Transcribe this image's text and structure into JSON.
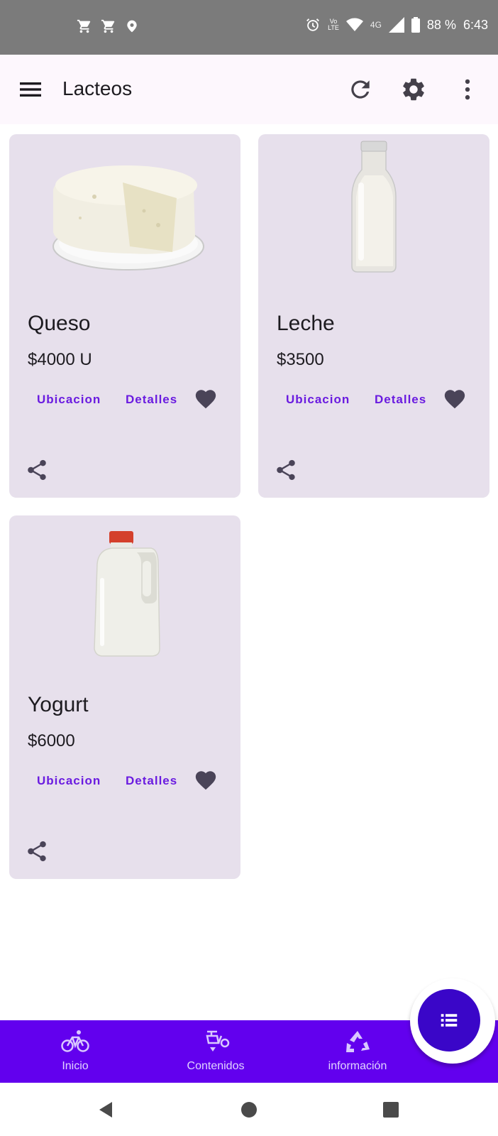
{
  "status_bar": {
    "battery": "88 %",
    "time": "6:43",
    "volte_top": "Vo",
    "volte_bottom": "LTE",
    "network": "4G",
    "icons": [
      "shopping-cart-icon",
      "shopping-cart-icon",
      "location-pin-icon",
      "alarm-icon",
      "volte-icon",
      "wifi-icon",
      "signal-icon",
      "battery-icon"
    ]
  },
  "app_bar": {
    "title": "Lacteos",
    "icons": [
      "menu-icon",
      "refresh-icon",
      "settings-icon",
      "more-vert-icon"
    ]
  },
  "products": [
    {
      "name": "Queso",
      "price": "$4000 U",
      "location_label": "Ubicacion",
      "details_label": "Detalles",
      "image": "cheese-image"
    },
    {
      "name": "Leche",
      "price": "$3500",
      "location_label": "Ubicacion",
      "details_label": "Detalles",
      "image": "milk-bottle-image"
    },
    {
      "name": "Yogurt",
      "price": "$6000",
      "location_label": "Ubicacion",
      "details_label": "Detalles",
      "image": "yogurt-jug-image"
    }
  ],
  "bottom_nav": {
    "items": [
      {
        "label": "Inicio",
        "icon": "bicycle-icon"
      },
      {
        "label": "Contenidos",
        "icon": "scooter-icon"
      },
      {
        "label": "información",
        "icon": "recycle-icon"
      }
    ],
    "fab_icon": "list-icon"
  },
  "colors": {
    "status_bar": "#7b7b7b",
    "app_bar": "#fdf7fd",
    "card": "#e7e0ec",
    "accent_text": "#6a1be0",
    "bottom_nav": "#6200ee",
    "fab": "#3a06c8"
  }
}
